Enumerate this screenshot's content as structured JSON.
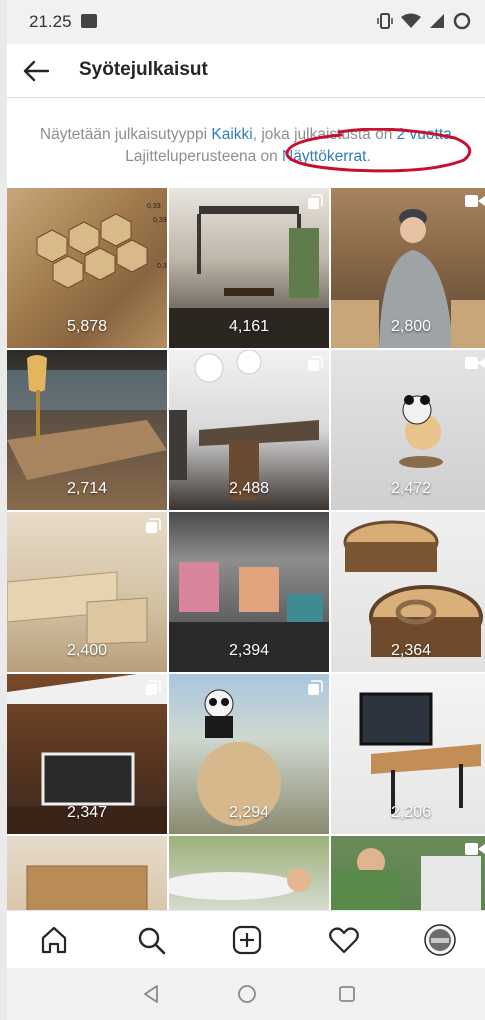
{
  "status": {
    "time": "21.25"
  },
  "header": {
    "title": "Syötejulkaisut"
  },
  "info": {
    "text_before": "Näytetään julkaisutyyppi ",
    "type_link": "Kaikki",
    "text_mid": ", joka julkaistusta on ",
    "period_link": "2 vuotta",
    "text_after": ". Lajitteluperusteena on ",
    "sort_link": "Näyttökerrat",
    "text_end": "."
  },
  "posts": [
    {
      "views": "5,878",
      "badge": ""
    },
    {
      "views": "4,161",
      "badge": "carousel-icon"
    },
    {
      "views": "2,800",
      "badge": "video-icon"
    },
    {
      "views": "2,714",
      "badge": ""
    },
    {
      "views": "2,488",
      "badge": "carousel-icon"
    },
    {
      "views": "2,472",
      "badge": "video-icon"
    },
    {
      "views": "2,400",
      "badge": "carousel-icon"
    },
    {
      "views": "2,394",
      "badge": ""
    },
    {
      "views": "2,364",
      "badge": ""
    },
    {
      "views": "2,347",
      "badge": "carousel-icon"
    },
    {
      "views": "2,294",
      "badge": "carousel-icon"
    },
    {
      "views": "2,206",
      "badge": ""
    },
    {
      "views": "",
      "badge": ""
    },
    {
      "views": "",
      "badge": ""
    },
    {
      "views": "",
      "badge": "video-icon"
    }
  ],
  "bottom_nav": [
    "home-icon",
    "search-icon",
    "add-icon",
    "heart-icon",
    "profile-avatar"
  ],
  "colors": {
    "link": "#2d7fbf",
    "annotation": "#c8102e"
  }
}
